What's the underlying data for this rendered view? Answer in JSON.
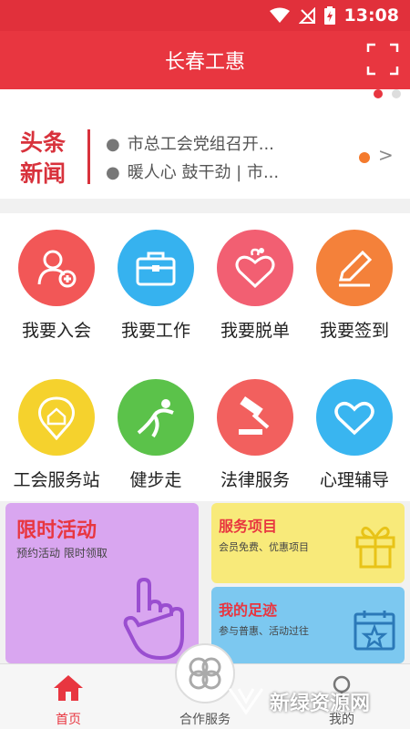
{
  "status_bar": {
    "time": "13:08"
  },
  "app": {
    "title": "长春工惠"
  },
  "news": {
    "logo_line1": "头条",
    "logo_line2": "新闻",
    "items": [
      "市总工会党组召开...",
      "暖人心 鼓干劲 | 市..."
    ],
    "arrow": ">"
  },
  "features": [
    {
      "label": "我要入会",
      "color": "#f25757",
      "icon": "user-plus-icon"
    },
    {
      "label": "我要工作",
      "color": "#36b2ef",
      "icon": "briefcase-icon"
    },
    {
      "label": "我要脱单",
      "color": "#f25f72",
      "icon": "hearts-icon"
    },
    {
      "label": "我要签到",
      "color": "#f4813a",
      "icon": "pencil-icon"
    },
    {
      "label": "工会服务站",
      "color": "#f5d22d",
      "icon": "home-pin-icon"
    },
    {
      "label": "健步走",
      "color": "#5bc24a",
      "icon": "runner-icon"
    },
    {
      "label": "法律服务",
      "color": "#f2605e",
      "icon": "gavel-icon"
    },
    {
      "label": "心理辅导",
      "color": "#39b5f0",
      "icon": "heart-icon"
    }
  ],
  "promos": {
    "limited": {
      "title": "限时活动",
      "subtitle": "预约活动 限时领取"
    },
    "services": {
      "title": "服务项目",
      "subtitle": "会员免费、优惠项目"
    },
    "footprint": {
      "title": "我的足迹",
      "subtitle": "参与普惠、活动过往"
    }
  },
  "tabs": [
    {
      "label": "首页",
      "active": true
    },
    {
      "label": "合作服务",
      "active": false
    },
    {
      "label": "我的",
      "active": false
    }
  ],
  "watermark": {
    "text": "新绿资源网"
  },
  "colors": {
    "brand": "#e83640",
    "active_tab": "#e83640"
  }
}
